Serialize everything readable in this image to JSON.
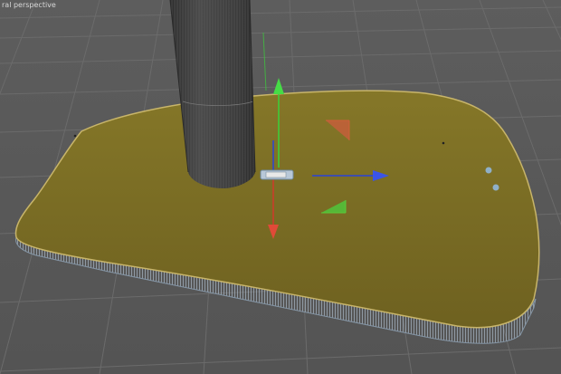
{
  "viewport": {
    "camera_label": "ral perspective"
  },
  "colors": {
    "background": "#585858",
    "grid_line": "#6a6a6a",
    "disc_fill": "#7a6c22",
    "disc_edge_highlight": "#c9b86a",
    "disc_rim": "#7f8fa0",
    "cylinder_fill": "#3e3e3e",
    "cylinder_wire": "#6e6e6e",
    "axis_x": "#d03a2a",
    "axis_y": "#3ad23a",
    "axis_z": "#2a44d8",
    "handle_plane_xz": "#d0603a",
    "handle_plane_xy": "#5ac83a"
  },
  "icons": {
    "move_gizmo": "move-manipulator-icon",
    "pivot": "pivot-handle-icon"
  }
}
